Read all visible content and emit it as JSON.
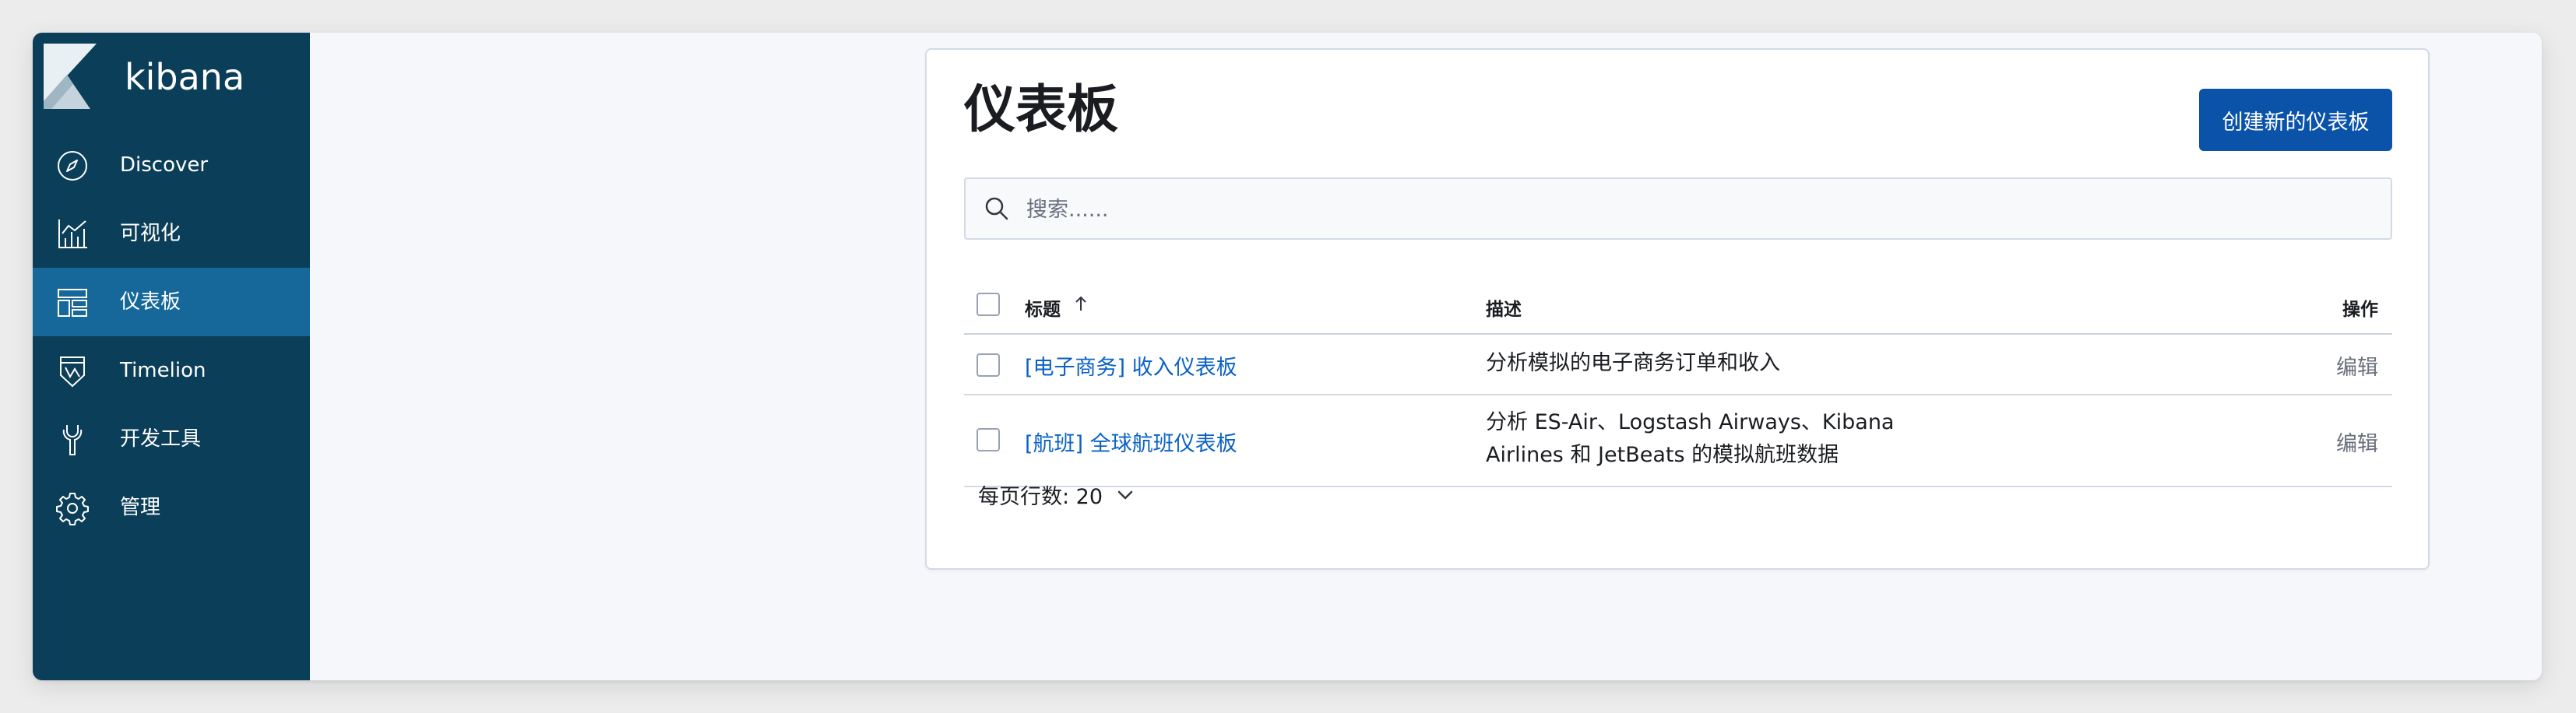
{
  "app": {
    "logo_text": "kibana"
  },
  "sidebar": {
    "items": [
      {
        "label": "Discover",
        "icon": "compass-icon"
      },
      {
        "label": "可视化",
        "icon": "chart-icon"
      },
      {
        "label": "仪表板",
        "icon": "dashboard-icon",
        "active": true
      },
      {
        "label": "Timelion",
        "icon": "timelion-shield-icon"
      },
      {
        "label": "开发工具",
        "icon": "wrench-icon"
      },
      {
        "label": "管理",
        "icon": "gear-icon"
      }
    ]
  },
  "main": {
    "title": "仪表板",
    "create_button": "创建新的仪表板",
    "search": {
      "placeholder": "搜索......",
      "value": ""
    },
    "table": {
      "columns": {
        "title": "标题",
        "description": "描述",
        "actions": "操作"
      },
      "rows": [
        {
          "title": "[电子商务] 收入仪表板",
          "description": "分析模拟的电子商务订单和收入",
          "action": "编辑"
        },
        {
          "title": "[航班] 全球航班仪表板",
          "description": "分析 ES-Air、Logstash Airways、Kibana Airlines 和 JetBeats 的模拟航班数据",
          "action": "编辑"
        }
      ]
    },
    "pagination": {
      "rows_per_page": "每页行数: 20"
    }
  },
  "colors": {
    "sidebar_bg": "#0b3e58",
    "sidebar_active": "#16689a",
    "primary_button": "#0a53a8",
    "link": "#0a62c4"
  }
}
